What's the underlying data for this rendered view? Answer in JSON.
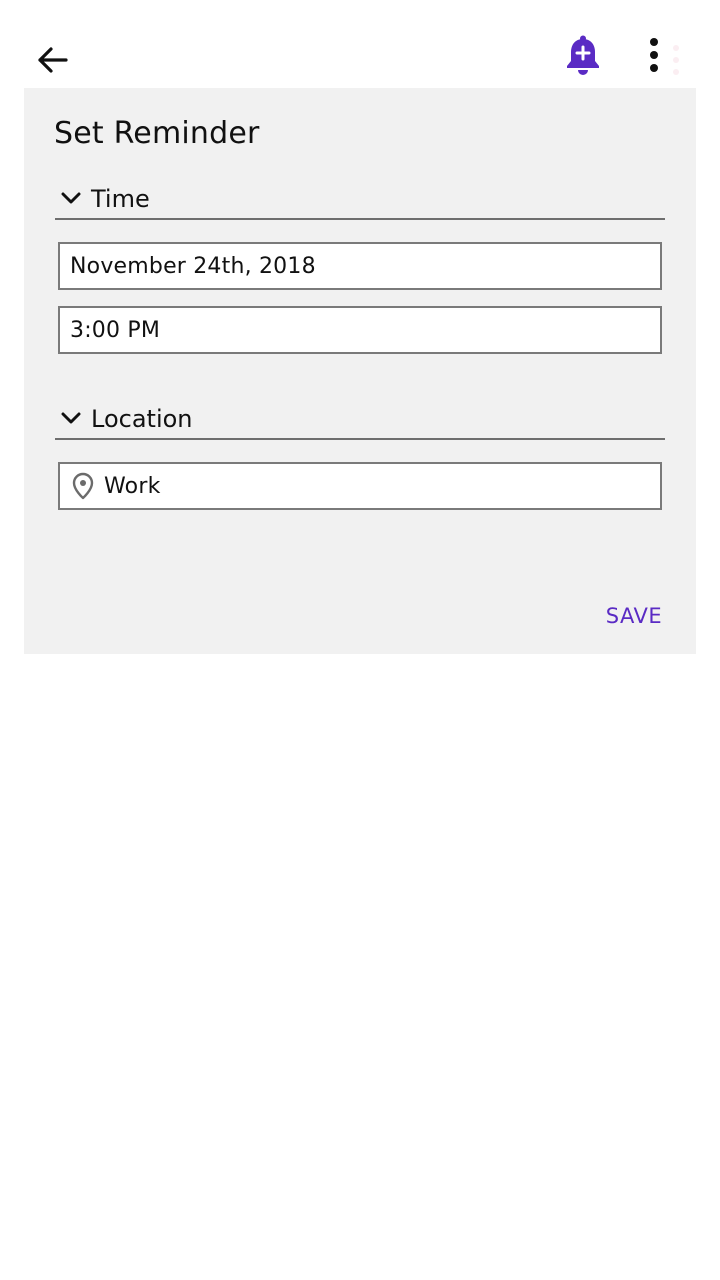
{
  "topbar": {
    "back_icon": "arrow-left-icon",
    "add_reminder_icon": "bell-plus-icon",
    "more_icon": "more-vertical-icon",
    "accent_color": "#5a2bc4"
  },
  "dialog": {
    "title": "Set Reminder",
    "time_section": {
      "label": "Time",
      "icon": "chevron-down-icon",
      "date_value": "November 24th, 2018",
      "time_value": "3:00 PM"
    },
    "location_section": {
      "label": "Location",
      "icon": "chevron-down-icon",
      "place_icon": "map-pin-icon",
      "place_value": "Work"
    },
    "save_label": "SAVE"
  }
}
